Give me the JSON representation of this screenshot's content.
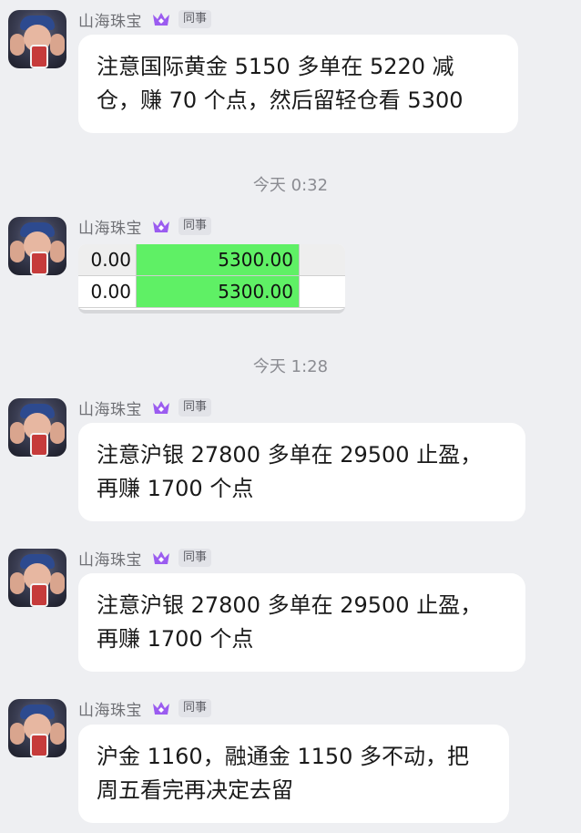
{
  "contact": {
    "name": "山海珠宝",
    "role_tag": "同事"
  },
  "messages": [
    {
      "lines": [
        "注意国际黄金 5150 多单在 5220 减",
        "仓，赚 70 个点，然后留轻仓看 5300"
      ]
    },
    {
      "type": "sheet",
      "rows": [
        {
          "a": "0.00",
          "b": "5300.00"
        },
        {
          "a": "0.00",
          "b": "5300.00"
        }
      ]
    },
    {
      "lines": [
        "注意沪银 27800 多单在 29500 止盈，",
        "再赚 1700 个点"
      ]
    },
    {
      "lines": [
        "注意沪银 27800 多单在 29500 止盈，",
        "再赚 1700 个点"
      ]
    },
    {
      "lines": [
        "沪金 1160，融通金 1150 多不动，把",
        "周五看完再决定去留"
      ]
    }
  ],
  "timestamps": [
    "今天 0:32",
    "今天 1:28"
  ],
  "colors": {
    "background": "#eeeff2",
    "bubble": "#ffffff",
    "crown": "#9b5cf0",
    "sheet_highlight": "#5ff065"
  }
}
